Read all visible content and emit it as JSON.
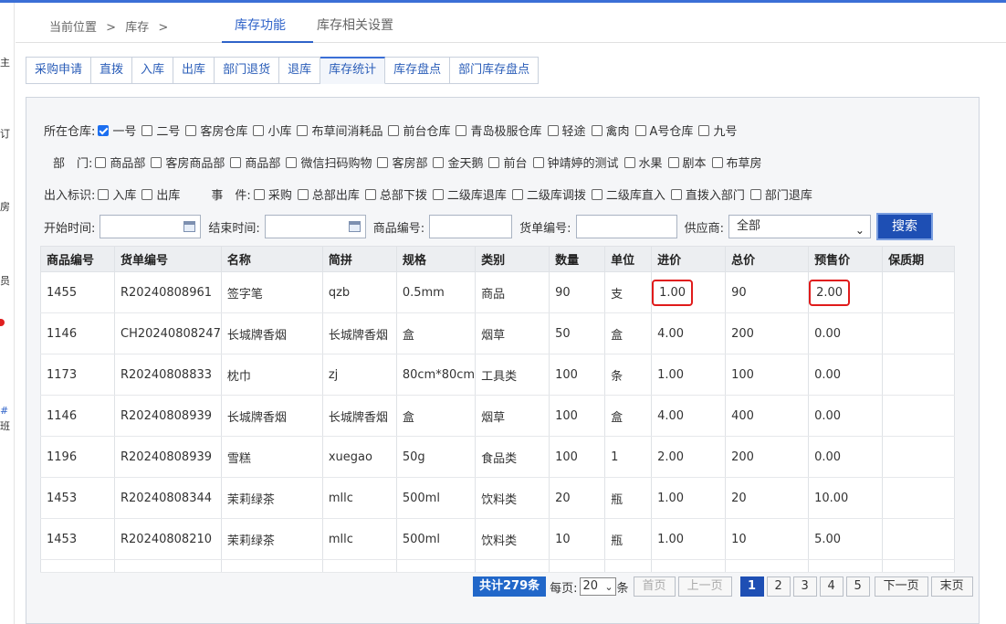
{
  "left_strip": [
    "主",
    "订",
    "房",
    "员",
    "#",
    "班"
  ],
  "breadcrumb": {
    "prefix": "当前位置",
    "sep": ">",
    "item": "库存",
    "sep2": ">"
  },
  "top_tabs": [
    {
      "label": "库存功能",
      "active": true
    },
    {
      "label": "库存相关设置",
      "active": false
    }
  ],
  "sub_tabs": [
    {
      "label": "采购申请",
      "active": false
    },
    {
      "label": "直拨",
      "active": false
    },
    {
      "label": "入库",
      "active": false
    },
    {
      "label": "出库",
      "active": false
    },
    {
      "label": "部门退货",
      "active": false
    },
    {
      "label": "退库",
      "active": false
    },
    {
      "label": "库存统计",
      "active": true
    },
    {
      "label": "库存盘点",
      "active": false
    },
    {
      "label": "部门库存盘点",
      "active": false
    }
  ],
  "filters": {
    "warehouse": {
      "label": "所在仓库:",
      "options": [
        {
          "label": "一号",
          "checked": true
        },
        {
          "label": "二号",
          "checked": false
        },
        {
          "label": "客房仓库",
          "checked": false
        },
        {
          "label": "小库",
          "checked": false
        },
        {
          "label": "布草间消耗品",
          "checked": false
        },
        {
          "label": "前台仓库",
          "checked": false
        },
        {
          "label": "青岛极服仓库",
          "checked": false
        },
        {
          "label": "轻途",
          "checked": false
        },
        {
          "label": "禽肉",
          "checked": false
        },
        {
          "label": "A号仓库",
          "checked": false
        },
        {
          "label": "九号",
          "checked": false
        }
      ]
    },
    "department": {
      "label": "部　门:",
      "options": [
        {
          "label": "商品部",
          "checked": false
        },
        {
          "label": "客房商品部",
          "checked": false
        },
        {
          "label": "商品部",
          "checked": false
        },
        {
          "label": "微信扫码购物",
          "checked": false
        },
        {
          "label": "客房部",
          "checked": false
        },
        {
          "label": "金天鹅",
          "checked": false
        },
        {
          "label": "前台",
          "checked": false
        },
        {
          "label": "钟靖婷的测试",
          "checked": false
        },
        {
          "label": "水果",
          "checked": false
        },
        {
          "label": "剧本",
          "checked": false
        },
        {
          "label": "布草房",
          "checked": false
        }
      ]
    },
    "io_flag": {
      "label": "出入标识:",
      "options": [
        {
          "label": "入库",
          "checked": false
        },
        {
          "label": "出库",
          "checked": false
        }
      ]
    },
    "event": {
      "label": "事　件:",
      "options": [
        {
          "label": "采购",
          "checked": false
        },
        {
          "label": "总部出库",
          "checked": false
        },
        {
          "label": "总部下拨",
          "checked": false
        },
        {
          "label": "二级库退库",
          "checked": false
        },
        {
          "label": "二级库调拨",
          "checked": false
        },
        {
          "label": "二级库直入",
          "checked": false
        },
        {
          "label": "直拨入部门",
          "checked": false
        },
        {
          "label": "部门退库",
          "checked": false
        }
      ]
    },
    "start_time_label": "开始时间:",
    "start_time_value": "",
    "end_time_label": "结束时间:",
    "end_time_value": "",
    "product_no_label": "商品编号:",
    "product_no_value": "",
    "bill_no_label": "货单编号:",
    "bill_no_value": "",
    "supplier_label": "供应商:",
    "supplier_value": "全部",
    "search_label": "搜索"
  },
  "table": {
    "headers": [
      "商品编号",
      "货单编号",
      "名称",
      "简拼",
      "规格",
      "类别",
      "数量",
      "单位",
      "进价",
      "总价",
      "预售价",
      "保质期"
    ],
    "rows": [
      [
        "1455",
        "R20240808961",
        "签字笔",
        "qzb",
        "0.5mm",
        "商品",
        "90",
        "支",
        "1.00",
        "90",
        "2.00",
        ""
      ],
      [
        "1146",
        "CH20240808247",
        "长城牌香烟",
        "长城牌香烟",
        "盒",
        "烟草",
        "50",
        "盒",
        "4.00",
        "200",
        "0.00",
        ""
      ],
      [
        "1173",
        "R20240808833",
        "枕巾",
        "zj",
        "80cm*80cm",
        "工具类",
        "100",
        "条",
        "1.00",
        "100",
        "0.00",
        ""
      ],
      [
        "1146",
        "R20240808939",
        "长城牌香烟",
        "长城牌香烟",
        "盒",
        "烟草",
        "100",
        "盒",
        "4.00",
        "400",
        "0.00",
        ""
      ],
      [
        "1196",
        "R20240808939",
        "雪糕",
        "xuegao",
        "50g",
        "食品类",
        "100",
        "1",
        "2.00",
        "200",
        "0.00",
        ""
      ],
      [
        "1453",
        "R20240808344",
        "茉莉绿茶",
        "mllc",
        "500ml",
        "饮料类",
        "20",
        "瓶",
        "1.00",
        "20",
        "10.00",
        ""
      ],
      [
        "1453",
        "R20240808210",
        "茉莉绿茶",
        "mllc",
        "500ml",
        "饮料类",
        "10",
        "瓶",
        "1.00",
        "10",
        "5.00",
        ""
      ]
    ]
  },
  "pager": {
    "total": "共计279条",
    "per_page_label": "每页:",
    "per_page_value": "20",
    "per_page_unit": "条",
    "first": "首页",
    "prev": "上一页",
    "pages": [
      "1",
      "2",
      "3",
      "4",
      "5"
    ],
    "current_page": "1",
    "next": "下一页",
    "last": "末页"
  },
  "colors": {
    "accent": "#2f63c9",
    "button": "#1e4fb4",
    "highlight": "#e01b1b",
    "checkbox": "#1b6ef0"
  }
}
